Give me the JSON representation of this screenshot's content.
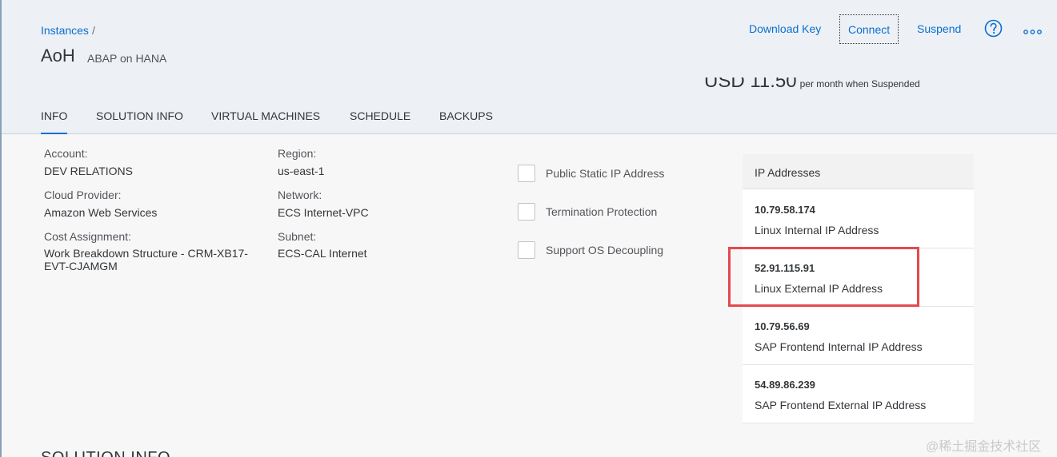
{
  "header": {
    "breadcrumb": {
      "link": "Instances",
      "separator": "/"
    },
    "title": "AoH",
    "subtitle": "ABAP on HANA",
    "cost": {
      "amount": "USD 11.50",
      "note": "per month when Suspended"
    },
    "actions": {
      "download_key": "Download Key",
      "connect": "Connect",
      "suspend": "Suspend"
    },
    "icons": {
      "help": "help-circle-icon",
      "more": "overflow-dots-icon"
    }
  },
  "tabs": [
    {
      "label": "INFO",
      "active": true
    },
    {
      "label": "SOLUTION INFO",
      "active": false
    },
    {
      "label": "VIRTUAL MACHINES",
      "active": false
    },
    {
      "label": "SCHEDULE",
      "active": false
    },
    {
      "label": "BACKUPS",
      "active": false
    }
  ],
  "info": {
    "account": {
      "label": "Account:",
      "value": "DEV RELATIONS"
    },
    "cloud_provider": {
      "label": "Cloud Provider:",
      "value": "Amazon Web Services"
    },
    "cost_assignment": {
      "label": "Cost Assignment:",
      "value": "Work Breakdown Structure - CRM-XB17-EVT-CJAMGM"
    },
    "region": {
      "label": "Region:",
      "value": "us-east-1"
    },
    "network": {
      "label": "Network:",
      "value": "ECS Internet-VPC"
    },
    "subnet": {
      "label": "Subnet:",
      "value": "ECS-CAL Internet"
    }
  },
  "options": [
    {
      "label": "Public Static IP Address",
      "checked": false
    },
    {
      "label": "Termination Protection",
      "checked": false
    },
    {
      "label": "Support OS Decoupling",
      "checked": false
    }
  ],
  "ip_addresses": {
    "title": "IP Addresses",
    "items": [
      {
        "ip": "10.79.58.174",
        "description": "Linux Internal IP Address"
      },
      {
        "ip": "52.91.115.91",
        "description": "Linux External IP Address"
      },
      {
        "ip": "10.79.56.69",
        "description": "SAP Frontend Internal IP Address"
      },
      {
        "ip": "54.89.86.239",
        "description": "SAP Frontend External IP Address"
      }
    ]
  },
  "next_section_title": "SOLUTION INFO",
  "watermark": "@稀土掘金技术社区",
  "colors": {
    "link": "#0a6ed1",
    "header_bg": "#edf1f5",
    "highlight": "#e5484d"
  }
}
